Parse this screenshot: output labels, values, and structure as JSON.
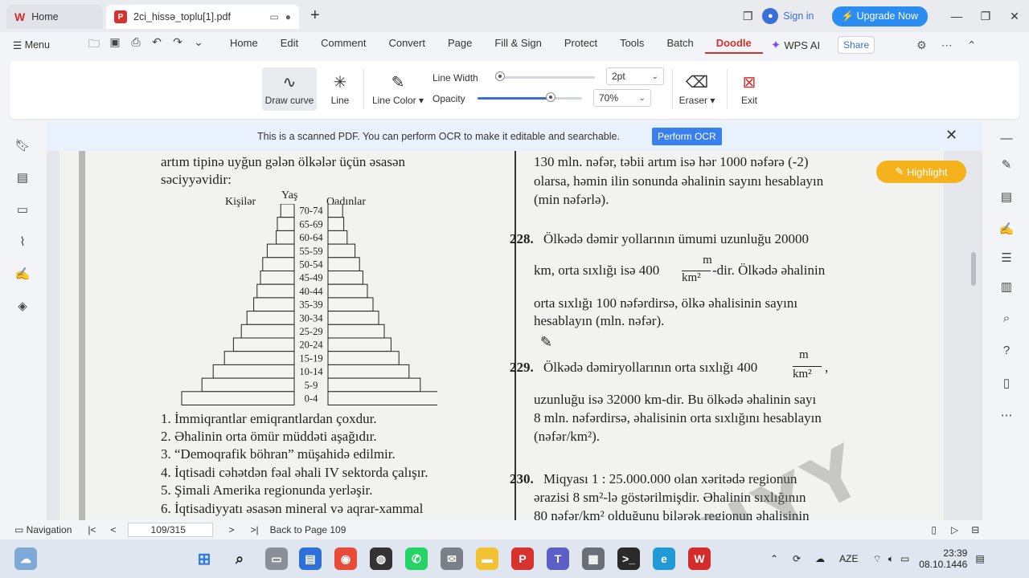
{
  "tabs": {
    "home": "Home",
    "doc": "2ci_hissə_toplu[1].pdf",
    "sign_in": "Sign in",
    "upgrade": "Upgrade Now"
  },
  "menu": {
    "menu_label": "Menu",
    "items": [
      "Home",
      "Edit",
      "Comment",
      "Convert",
      "Page",
      "Fill & Sign",
      "Protect",
      "Tools",
      "Batch",
      "Doodle"
    ],
    "active": "Doodle",
    "wps_ai": "WPS AI",
    "share": "Share"
  },
  "toolbar": {
    "draw_curve": "Draw curve",
    "line": "Line",
    "line_color": "Line Color",
    "line_width_label": "Line Width",
    "line_width_value": "2pt",
    "opacity_label": "Opacity",
    "opacity_value": "70%",
    "opacity_fraction": 0.7,
    "line_width_fraction": 0.05,
    "eraser": "Eraser",
    "exit": "Exit"
  },
  "ocr": {
    "message": "This is a scanned PDF. You can perform OCR to make it editable and searchable.",
    "button": "Perform OCR"
  },
  "highlight": "Highlight",
  "page": {
    "left": {
      "line1": "artım tipinə uyğun gələn ölkələr üçün əsasən",
      "line2": "səciyyəvidir:",
      "males": "Kişilər",
      "age": "Yaş",
      "females": "Qadınlar",
      "ages": [
        "70-74",
        "65-69",
        "60-64",
        "55-59",
        "50-54",
        "45-49",
        "40-44",
        "35-39",
        "30-34",
        "25-29",
        "20-24",
        "15-19",
        "10-14",
        "5-9",
        "0-4"
      ],
      "options": [
        "1. İmmiqrantlar emiqrantlardan çoxdur.",
        "2. Əhalinin orta ömür müddəti aşağıdır.",
        "3. “Demoqrafik böhran” müşahidə edilmir.",
        "4. İqtisadi cəhətdən fəal əhali IV sektorda çalışır.",
        "5. Şimali Amerika regionunda yerləşir.",
        "6. İqtisadiyyatı əsasən mineral və aqrar-xammal"
      ]
    },
    "right": {
      "p1": "130 mln. nəfər, təbii artım isə hər 1000 nəfərə (-2)",
      "p2": "olarsa, həmin ilin sonunda əhalinin sayını hesablayın",
      "p3": "(min nəfərlə).",
      "q228_num": "228.",
      "q228_a": "Ölkədə dəmir yollarının ümumi uzunluğu 20000",
      "q228_b": "km, orta sıxlığı isə 400",
      "q228_c": "-dir. Ölkədə əhalinin",
      "q228_d": "orta sıxlığı 100 nəfərdirsə, ölkə əhalisinin sayını",
      "q228_e": "hesablayın (mln. nəfər).",
      "frac_num": "m",
      "frac_den": "km²",
      "q229_num": "229.",
      "q229_a": "Ölkədə dəmiryollarının orta sıxlığı 400",
      "q229_comma": ",",
      "q229_b": "uzunluğu isə 32000 km-dir. Bu ölkədə əhalinin sayı",
      "q229_c": "8 mln. nəfərdirsə, əhalisinin orta sıxlığını hesablayın",
      "q229_d": "(nəfər/km²).",
      "q230_num": "230.",
      "q230_a": "Miqyası 1 : 25.000.000 olan xəritədə regionun",
      "q230_b": "ərazisi 8 sm²-lə göstərilmişdir. Əhalinin sıxlığının",
      "q230_c": "80 nəfər/km² olduğunu bilərək regionun əhalisinin"
    },
    "watermark": "NYY"
  },
  "status": {
    "navigation": "Navigation",
    "page_box": "109/315",
    "back": "Back to Page 109"
  },
  "taskbar": {
    "lang": "AZE",
    "time": "23:39",
    "date": "08.10.1446"
  },
  "pyramid": {
    "males": [
      0.12,
      0.15,
      0.16,
      0.24,
      0.28,
      0.3,
      0.33,
      0.36,
      0.42,
      0.47,
      0.54,
      0.62,
      0.72,
      0.82,
      1.0
    ],
    "females": [
      0.13,
      0.14,
      0.17,
      0.24,
      0.28,
      0.31,
      0.35,
      0.4,
      0.45,
      0.5,
      0.56,
      0.63,
      0.72,
      0.82,
      1.0
    ]
  }
}
